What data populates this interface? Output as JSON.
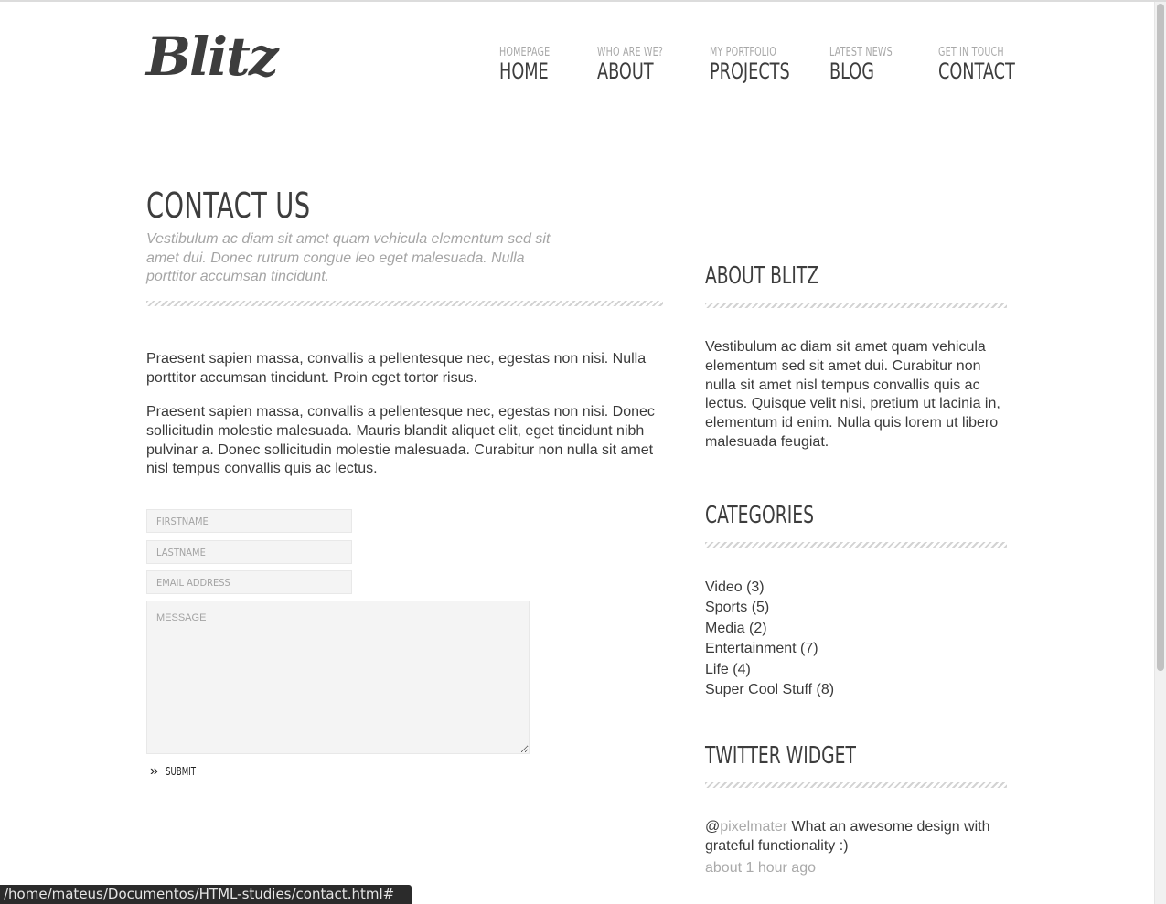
{
  "logo": "Blitz",
  "nav": [
    {
      "sub": "HOMEPAGE",
      "label": "HOME"
    },
    {
      "sub": "WHO ARE WE?",
      "label": "ABOUT"
    },
    {
      "sub": "MY PORTFOLIO",
      "label": "PROJECTS"
    },
    {
      "sub": "LATEST NEWS",
      "label": "BLOG"
    },
    {
      "sub": "GET IN TOUCH",
      "label": "CONTACT"
    }
  ],
  "main": {
    "title": "CONTACT US",
    "subtitle": "Vestibulum ac diam sit amet quam vehicula elementum sed sit amet dui. Donec rutrum congue leo eget malesuada. Nulla porttitor accumsan tincidunt.",
    "paragraphs": [
      "Praesent sapien massa, convallis a pellentesque nec, egestas non nisi. Nulla porttitor accumsan tincidunt. Proin eget tortor risus.",
      "Praesent sapien massa, convallis a pellentesque nec, egestas non nisi. Donec sollicitudin molestie malesuada. Mauris blandit aliquet elit, eget tincidunt nibh pulvinar a. Donec sollicitudin molestie malesuada. Curabitur non nulla sit amet nisl tempus convallis quis ac lectus."
    ]
  },
  "form": {
    "firstname_placeholder": "FIRSTNAME",
    "lastname_placeholder": "LASTNAME",
    "email_placeholder": "EMAIL ADDRESS",
    "message_placeholder": "MESSAGE",
    "submit_label": "SUBMIT",
    "submit_icon": "double-chevron-right-icon"
  },
  "sidebar": {
    "about_title": "ABOUT BLITZ",
    "about_text": "Vestibulum ac diam sit amet quam vehicula elementum sed sit amet dui. Curabitur non nulla sit amet nisl tempus convallis quis ac lectus. Quisque velit nisi, pretium ut lacinia in, elementum id enim. Nulla quis lorem ut libero malesuada feugiat.",
    "categories_title": "CATEGORIES",
    "categories": [
      "Video (3)",
      "Sports (5)",
      "Media (2)",
      "Entertainment (7)",
      "Life (4)",
      "Super Cool Stuff (8)"
    ],
    "twitter_title": "TWITTER WIDGET",
    "tweet_at": "@",
    "tweet_handle": "pixelmater",
    "tweet_text": " What an awesome design with grateful functionality :)",
    "tweet_time": "about 1 hour ago"
  },
  "status_url": "/home/mateus/Documentos/HTML-studies/contact.html#",
  "colors": {
    "heading": "#3d3d3d",
    "muted": "#a5a5a5",
    "stripe": "#d3d3d3",
    "field_bg": "#f4f4f4"
  }
}
